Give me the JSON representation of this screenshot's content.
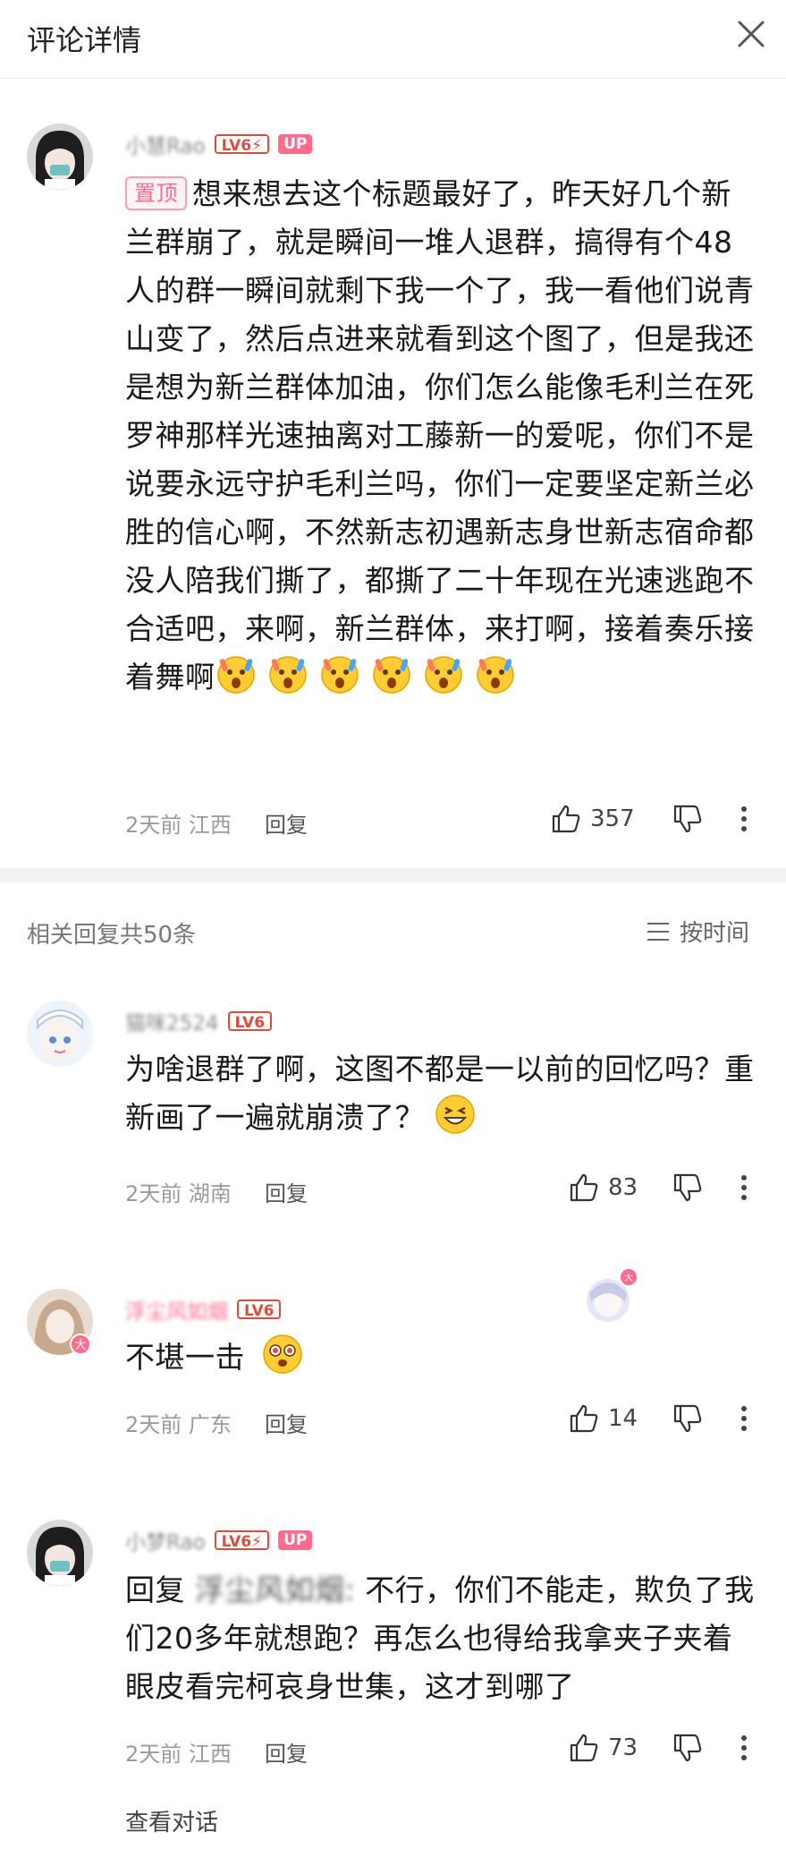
{
  "header": {
    "title": "评论详情",
    "close_icon": "close-icon"
  },
  "main_comment": {
    "username": "小慧Rao",
    "level": "LV6⚡",
    "up_badge": "UP",
    "pin_label": "置顶",
    "text": "想来想去这个标题最好了，昨天好几个新兰群崩了，就是瞬间一堆人退群，搞得有个48人的群一瞬间就剩下我一个了，我一看他们说青山变了，然后点进来就看到这个图了，但是我还是想为新兰群体加油，你们怎么能像毛利兰在死罗神那样光速抽离对工藤新一的爱呢，你们不是说要永远守护毛利兰吗，你们一定要坚定新兰必胜的信心啊，不然新志初遇新志身世新志宿命都没人陪我们撕了，都撕了二十年现在光速逃跑不合适吧，来啊，新兰群体，来打啊，接着奏乐接着舞啊",
    "emoji_count": 6,
    "time": "2天前",
    "location": "江西",
    "reply_label": "回复",
    "likes": "357"
  },
  "replies_section": {
    "title": "相关回复共50条",
    "sort_label": "按时间"
  },
  "replies": [
    {
      "username": "猫咪2524",
      "level": "LV6",
      "text": "为啥退群了啊，这图不都是一以前的回忆吗？重新画了一遍就崩溃了？",
      "time": "2天前",
      "location": "湖南",
      "reply_label": "回复",
      "likes": "83"
    },
    {
      "username": "浮尘风如烟",
      "level": "LV6",
      "text": "不堪一击",
      "time": "2天前",
      "location": "广东",
      "reply_label": "回复",
      "likes": "14"
    },
    {
      "username": "小梦Rao",
      "level": "LV6⚡",
      "up_badge": "UP",
      "reply_prefix": "回复",
      "reply_target": "浮尘风如烟:",
      "text": " 不行，你们不能走，欺负了我们20多年就想跑？再怎么也得给我拿夹子夹着眼皮看完柯哀身世集，这才到哪了",
      "time": "2天前",
      "location": "江西",
      "reply_label": "回复",
      "likes": "73"
    }
  ],
  "view_conversation": "查看对话",
  "colors": {
    "level_red": "#e04b3b",
    "up_pink": "#ff6b8b",
    "gray_text": "#9a9a9a",
    "divider": "#f2f2f2"
  }
}
